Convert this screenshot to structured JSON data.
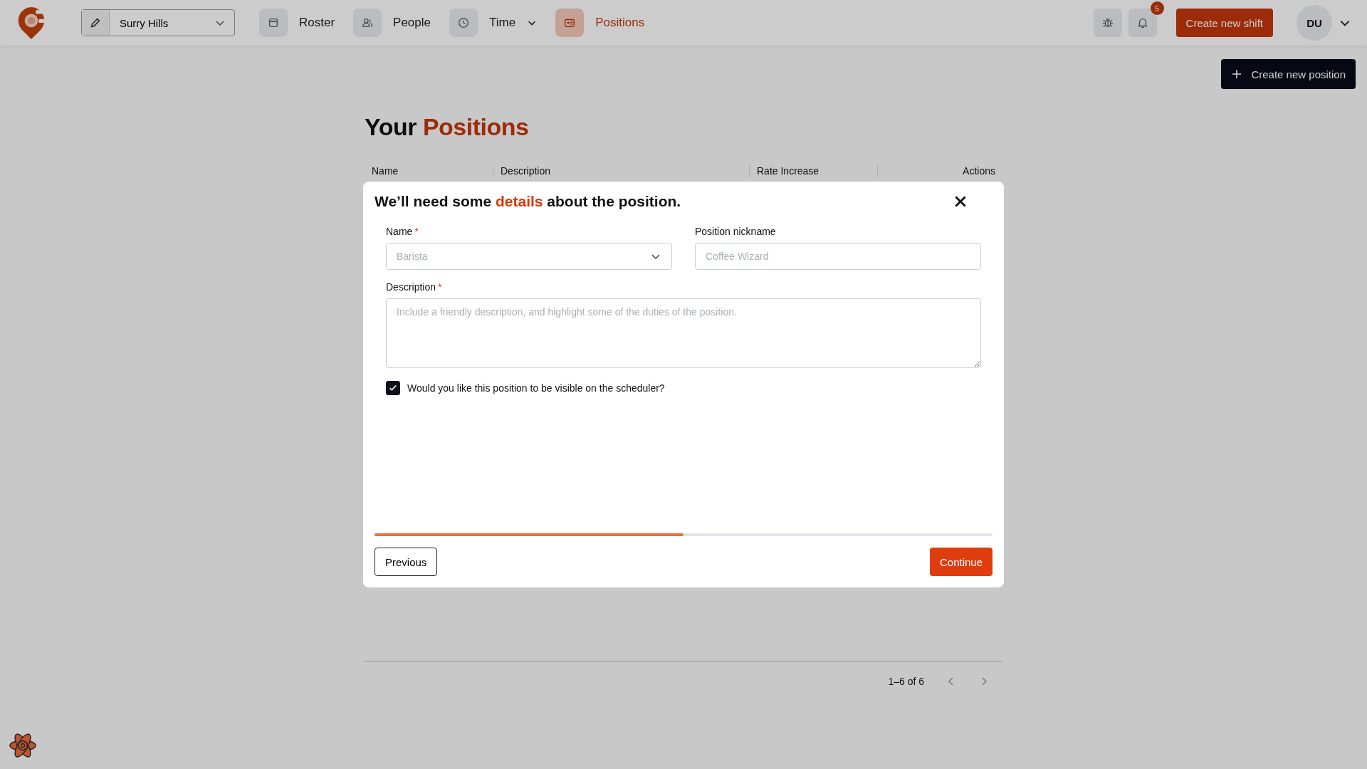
{
  "topbar": {
    "location": "Surry Hills",
    "nav": [
      {
        "label": "Roster",
        "selected": false,
        "dropdown": false
      },
      {
        "label": "People",
        "selected": false,
        "dropdown": false
      },
      {
        "label": "Time",
        "selected": false,
        "dropdown": true
      },
      {
        "label": "Positions",
        "selected": true,
        "dropdown": false
      }
    ],
    "notification_count": "5",
    "create_shift": "Create new shift",
    "avatar": "DU"
  },
  "create_position": "Create new position",
  "page_title": "Your **Positions**",
  "table": {
    "columns": [
      "Name",
      "Description",
      "Rate Increase",
      "Actions"
    ]
  },
  "modal": {
    "title": "We’ll need some **details** about the position.",
    "fields": [
      {
        "kind": "select",
        "label": "Name",
        "required_mark": "*",
        "placeholder": "Barista"
      },
      {
        "kind": "text",
        "label": "Position nickname",
        "placeholder": "Coffee Wizard"
      },
      {
        "kind": "textarea",
        "label": "Description",
        "required_mark": "*",
        "placeholder": "Include a friendly description, and highlight some of the duties of the position."
      }
    ],
    "visible_checkbox": {
      "label": "Would you like this position to be visible on the scheduler?",
      "checked": true
    },
    "progress": {
      "level": 0.5
    },
    "previous": "Previous",
    "continue": "Continue"
  },
  "pagination": {
    "range": "1–6 of 6"
  }
}
